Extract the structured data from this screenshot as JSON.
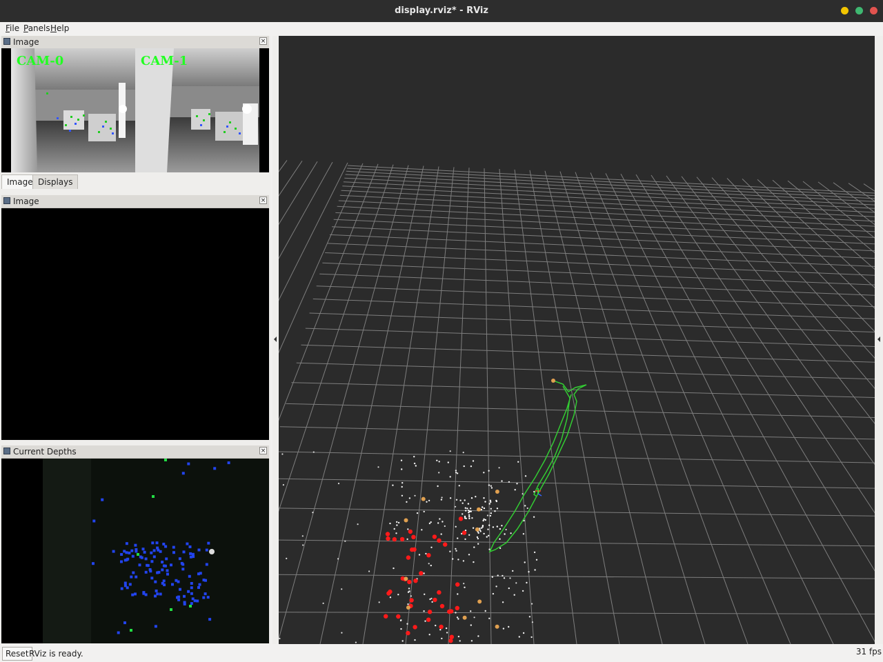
{
  "window": {
    "title": "display.rviz* - RViz"
  },
  "menu": [
    {
      "label": "File",
      "u": "F",
      "rest": "ile"
    },
    {
      "label": "Panels",
      "u": "P",
      "rest": "anels"
    },
    {
      "label": "Help",
      "u": "H",
      "rest": "elp"
    }
  ],
  "panels": {
    "image_top": {
      "title": "Image",
      "close": "×",
      "cam0_label": "CAM-0",
      "cam1_label": "CAM-1"
    },
    "tabs": [
      {
        "label": "Image"
      },
      {
        "label": "Displays"
      }
    ],
    "image_mid": {
      "title": "Image",
      "close": "×"
    },
    "depths": {
      "title": "Current Depths",
      "close": "×"
    }
  },
  "status": {
    "reset_label": "Reset",
    "message": "RViz is ready.",
    "fps": "31 fps"
  },
  "colors": {
    "titlebar": "#2d2d2d",
    "viewport_bg": "#2b2b2b",
    "grid": "#a0a0a0",
    "trajectory": "#33cc33",
    "landmark_red": "#ff1a1a",
    "landmark_orange": "#e0a050",
    "cam_label": "#22ff22"
  }
}
